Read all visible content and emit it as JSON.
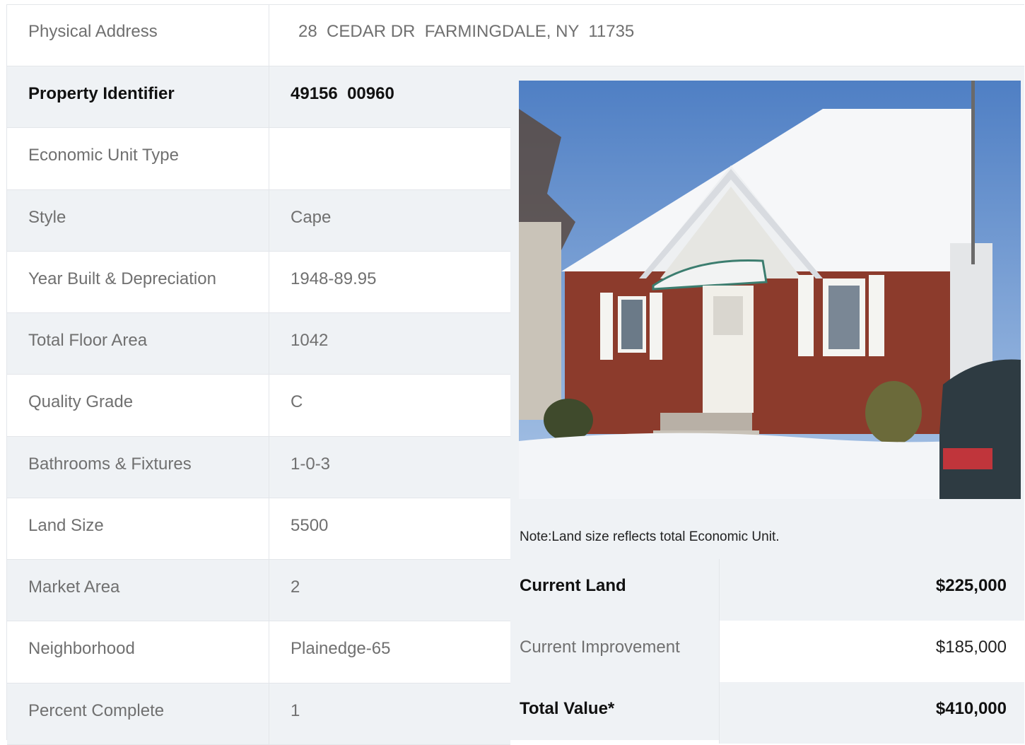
{
  "address": {
    "label": "Physical Address",
    "value": "28  CEDAR DR  FARMINGDALE, NY  11735"
  },
  "details": [
    {
      "label": "Property Identifier",
      "value": "49156  00960",
      "bold": true
    },
    {
      "label": "Economic Unit Type",
      "value": ""
    },
    {
      "label": "Style",
      "value": "Cape"
    },
    {
      "label": "Year Built & Depreciation",
      "value": "1948-89.95"
    },
    {
      "label": "Total Floor Area",
      "value": "1042"
    },
    {
      "label": "Quality Grade",
      "value": "C"
    },
    {
      "label": "Bathrooms & Fixtures",
      "value": "1-0-3"
    },
    {
      "label": "Land Size",
      "value": "5500"
    },
    {
      "label": "Market Area",
      "value": "2"
    },
    {
      "label": "Neighborhood",
      "value": "Plainedge-65"
    },
    {
      "label": "Percent Complete",
      "value": "1"
    }
  ],
  "note": "Note:Land size reflects total Economic Unit.",
  "values": [
    {
      "label": "Current Land",
      "value": "$225,000",
      "bold": true
    },
    {
      "label": "Current Improvement",
      "value": "$185,000",
      "bold": false
    },
    {
      "label": "Total Value*",
      "value": "$410,000",
      "bold": true
    }
  ],
  "colors": {
    "row_shade": "#eff2f5",
    "border": "#e3e6ea",
    "text_muted": "#707070",
    "text_strong": "#111111"
  }
}
